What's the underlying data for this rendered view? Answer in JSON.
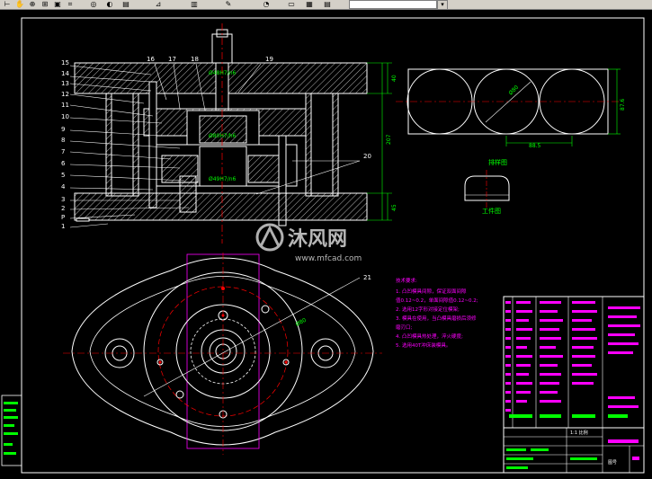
{
  "toolbar": {
    "icons": [
      "pan-icon",
      "zoom-realtime-icon",
      "zoom-window-icon",
      "zoom-previous-icon",
      "properties-icon",
      "design-center-icon",
      "tool-palettes-icon",
      "sheet-set-icon",
      "markup-icon",
      "calc-icon",
      "layer-icon"
    ],
    "combo_value": ""
  },
  "drawing": {
    "part_numbers_left": [
      "15",
      "14",
      "13",
      "12",
      "11",
      "10",
      "9",
      "8",
      "7",
      "6",
      "5",
      "4",
      "3",
      "2",
      "P",
      "1"
    ],
    "part_numbers_top": [
      "16",
      "17",
      "18",
      "19"
    ],
    "callout_20": "20",
    "callout_21": "21",
    "dim_right_1": "40",
    "dim_right_2": "207",
    "dim_right_3": "45",
    "strip_dim_width": "88.5",
    "strip_dim_height": "87.6",
    "strip_label_dia": "Ø80",
    "part_label_1": "排样图",
    "part_label_2": "工件图",
    "dim_shaft": "Ø48H7/n6",
    "dim_punch": "Ø80H7/h6",
    "dim_die": "Ø49H7/n6",
    "dim_plan": "Ø80"
  },
  "tech_notes": {
    "title": "技术要求:",
    "lines": [
      "1. 凸凹模具间隙，保证双面间隙",
      "值0.12~0.2，单面间隙值0.12~0.2;",
      "2. 选用12字形对接定位模架;",
      "3. 模具在使用，当凸模具磨损后须修",
      "磨刃口;",
      "4. 凸凹模具热处理，淬火硬度;",
      "5. 选用40T冲床装模具。"
    ]
  },
  "title_block": {
    "scale": "1:1 比例",
    "drawing_no": "图号"
  },
  "watermark": {
    "brand": "沐风网",
    "url": "www.mfcad.com"
  },
  "colors": {
    "background": "#000000",
    "lines": "#ffffff",
    "dims": "#00ff00",
    "labels": "#ff00ff",
    "hatch": "#ffffff",
    "center": "#ff0000"
  }
}
